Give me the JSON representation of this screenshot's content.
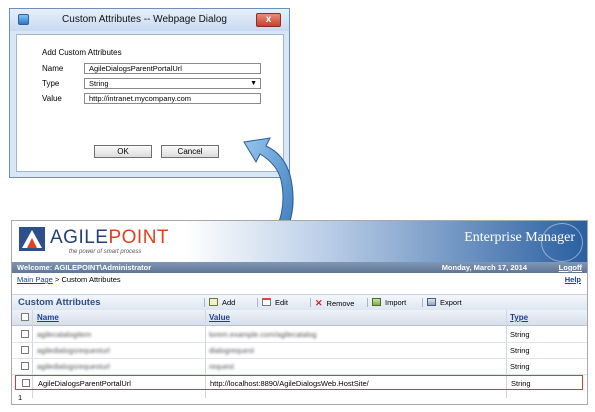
{
  "dialog": {
    "title": "Custom Attributes -- Webpage Dialog",
    "close_label": "x",
    "heading": "Add Custom Attributes",
    "fields": {
      "name_label": "Name",
      "name_value": "AgileDialogsParentPortalUrl",
      "type_label": "Type",
      "type_value": "String",
      "value_label": "Value",
      "value_value": "http://intranet.mycompany.com"
    },
    "ok_label": "OK",
    "cancel_label": "Cancel"
  },
  "app": {
    "logo": {
      "brand": "AGILEPOINT",
      "brand_prefix": "AGILE",
      "brand_suffix": "POINT",
      "tagline": "the power of smart process"
    },
    "product_title": "Enterprise Manager",
    "welcome": "Welcome: AGILEPOINT\\Administrator",
    "date": "Monday, March 17, 2014",
    "logoff": "Logoff",
    "breadcrumb": {
      "home": "Main Page",
      "separator": ">",
      "current": "Custom Attributes"
    },
    "help": "Help",
    "section_title": "Custom Attributes",
    "toolbar": {
      "add": "Add",
      "edit": "Edit",
      "remove": "Remove",
      "import": "Import",
      "export": "Export"
    },
    "table": {
      "columns": [
        "Name",
        "Value",
        "Type"
      ],
      "rows": [
        {
          "name": "agilecatalogitem",
          "value": "lorem.example.com/agilecatalog",
          "type": "String",
          "blurred": true
        },
        {
          "name": "agiledialogsrequesturl",
          "value": "dialogrequest",
          "type": "String",
          "blurred": true
        },
        {
          "name": "agiledialogsrequesturl",
          "value": "request",
          "type": "String",
          "blurred": true
        },
        {
          "name": "AgileDialogsParentPortalUrl",
          "value": "http://localhost:8890/AgileDialogsWeb.HostSite/",
          "type": "String",
          "blurred": false
        }
      ]
    },
    "pager": "1"
  },
  "colors": {
    "accent_blue": "#1c3f94",
    "highlight_red": "#d73a3a",
    "arrow_blue": "#3f86c9"
  }
}
